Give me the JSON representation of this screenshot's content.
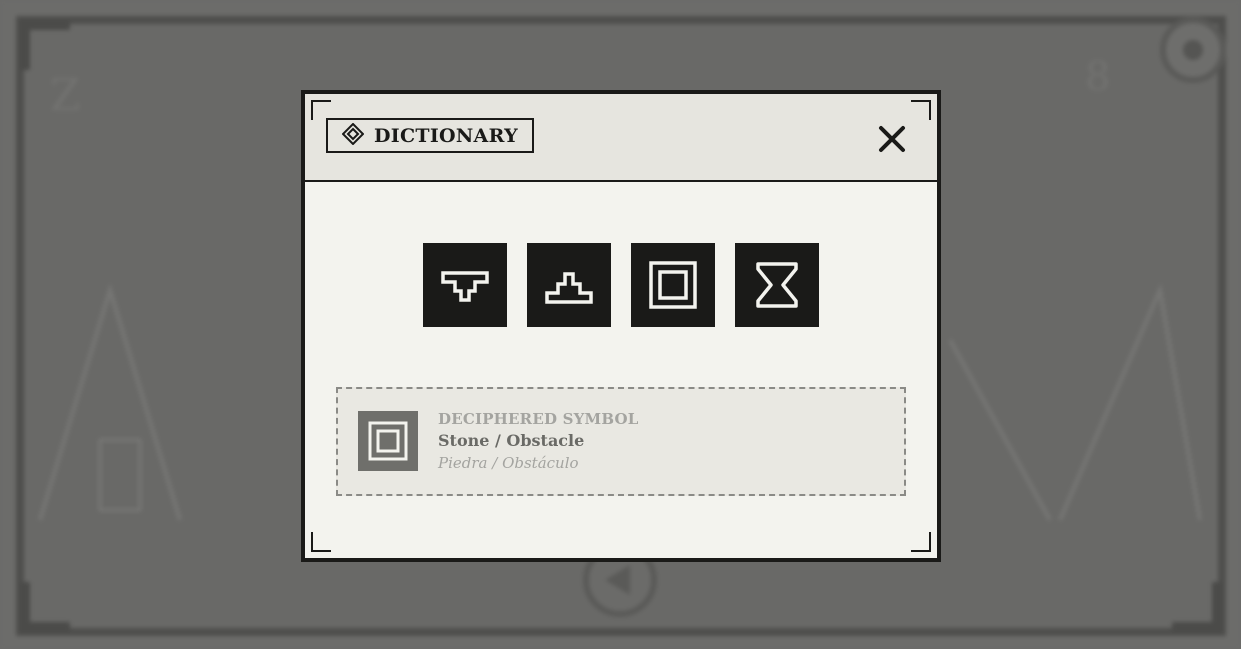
{
  "colors": {
    "ink": "#1a1a18",
    "paper": "#f3f3ee",
    "header_paper": "#e6e5df",
    "dim_backdrop": "#6b6b69",
    "muted_text": "#a4a4a0",
    "secondary_text": "#6a6a66"
  },
  "dictionary": {
    "title": "DICTIONARY",
    "title_icon": "diamond-icon",
    "close_icon": "close-icon",
    "symbols": [
      {
        "icon": "inverted-step-glyph-icon"
      },
      {
        "icon": "stepped-pyramid-glyph-icon"
      },
      {
        "icon": "stone-square-glyph-icon"
      },
      {
        "icon": "hourglass-x-glyph-icon"
      }
    ],
    "deciphered": {
      "label": "DECIPHERED SYMBOL",
      "name": "Stone / Obstacle",
      "translation": "Piedra / Obstáculo",
      "icon": "stone-square-glyph-icon"
    }
  }
}
